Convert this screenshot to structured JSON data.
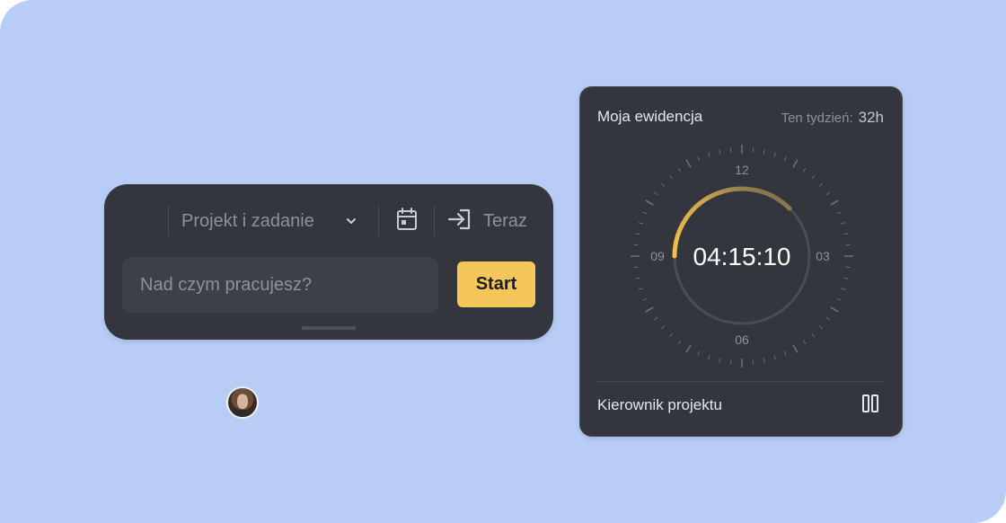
{
  "entry_widget": {
    "project_placeholder": "Projekt i zadanie",
    "now_label": "Teraz",
    "task_placeholder": "Nad czym pracujesz?",
    "start_label": "Start",
    "icons": {
      "avatar": "user-avatar",
      "chevron": "chevron-down-icon",
      "calendar": "calendar-icon",
      "enter": "login-arrow-icon"
    }
  },
  "timer_widget": {
    "title": "Moja ewidencja",
    "week_label": "Ten tydzień:",
    "week_value": "32h",
    "elapsed": "04:15:10",
    "dial_labels": {
      "top": "12",
      "right": "03",
      "bottom": "06",
      "left": "09"
    },
    "progress_arc": {
      "from_hour": 9,
      "to_hour": 1.5
    },
    "role": "Kierownik projektu",
    "icons": {
      "pause": "pause-icon"
    }
  },
  "colors": {
    "background": "#b8cdf6",
    "widget": "#33363d",
    "accent": "#f5c65a",
    "muted_text": "#8e9199"
  }
}
